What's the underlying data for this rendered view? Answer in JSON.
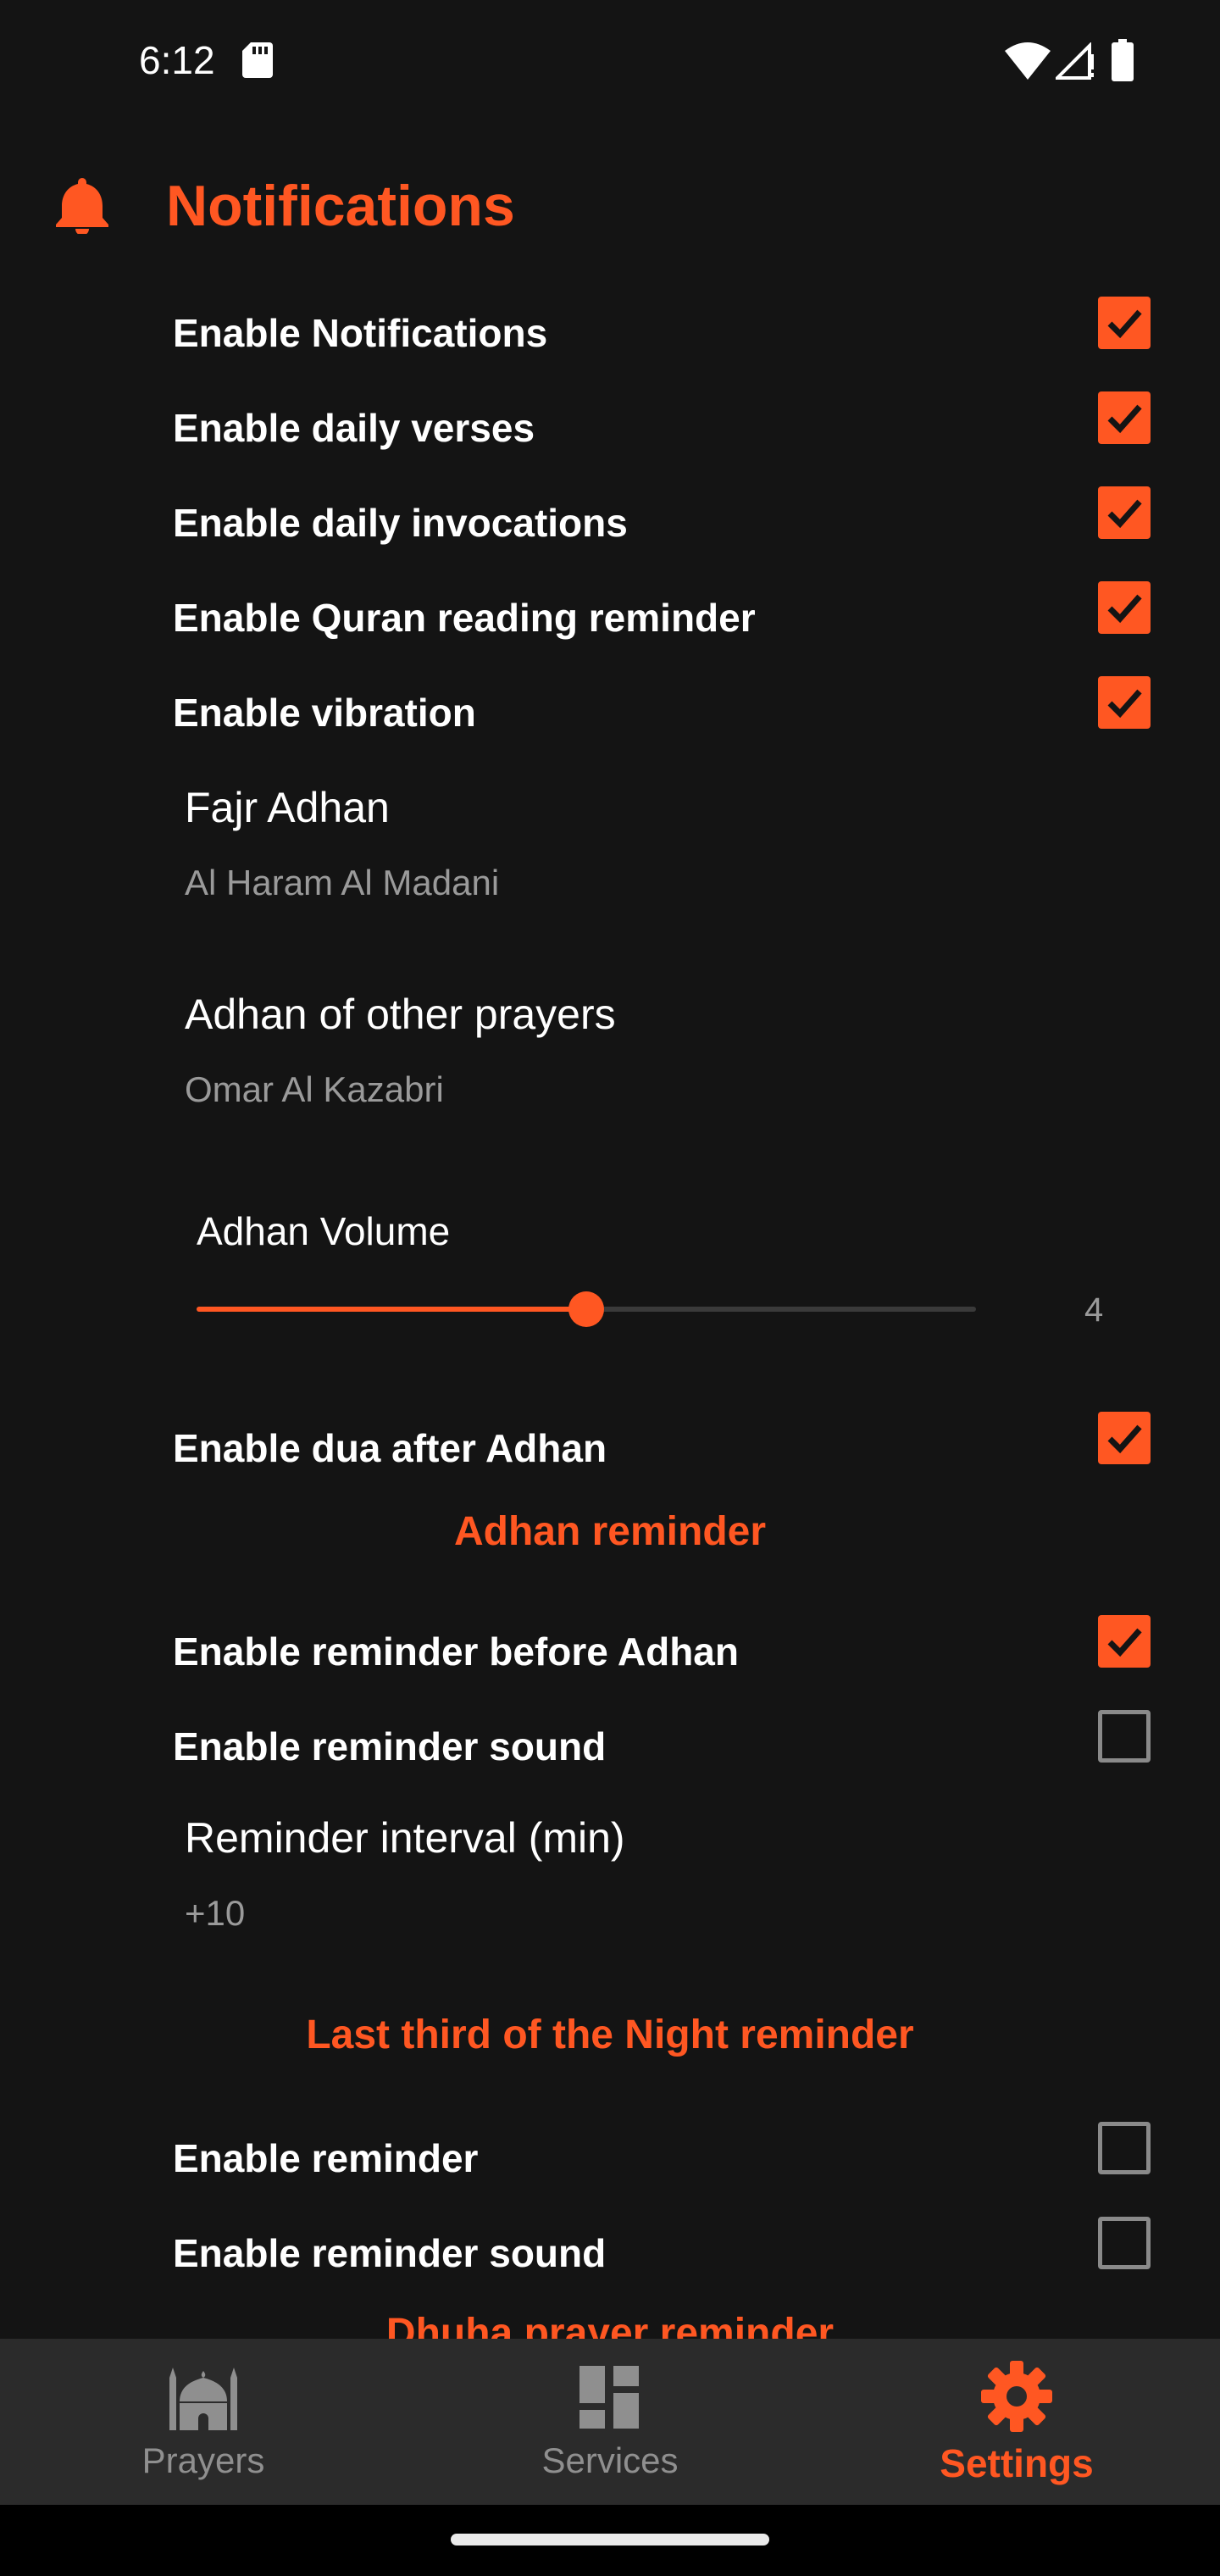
{
  "status_bar": {
    "time": "6:12"
  },
  "colors": {
    "accent": "#FF5722",
    "background": "#141414",
    "nav_background": "#2b2b2b",
    "secondary_text": "#9a9a9a"
  },
  "notifications": {
    "header": "Notifications",
    "header_icon": "bell-icon",
    "toggles": [
      {
        "label": "Enable Notifications",
        "checked": true
      },
      {
        "label": "Enable daily verses",
        "checked": true
      },
      {
        "label": "Enable daily invocations",
        "checked": true
      },
      {
        "label": "Enable Quran reading reminder",
        "checked": true
      },
      {
        "label": "Enable vibration",
        "checked": true
      }
    ],
    "fajr_adhan": {
      "title": "Fajr Adhan",
      "value": "Al Haram Al Madani"
    },
    "other_adhan": {
      "title": "Adhan of other prayers",
      "value": "Omar Al Kazabri"
    },
    "volume": {
      "title": "Adhan Volume",
      "value": "4",
      "fraction": 0.5
    },
    "dua_after_adhan": {
      "label": "Enable dua after Adhan",
      "checked": true
    }
  },
  "adhan_reminder": {
    "header": "Adhan reminder",
    "toggles": [
      {
        "label": "Enable reminder before Adhan",
        "checked": true
      },
      {
        "label": "Enable reminder sound",
        "checked": false
      }
    ],
    "interval": {
      "title": "Reminder interval (min)",
      "value": "+10"
    }
  },
  "night_reminder": {
    "header": "Last third of the Night reminder",
    "toggles": [
      {
        "label": "Enable reminder",
        "checked": false
      },
      {
        "label": "Enable reminder sound",
        "checked": false
      }
    ]
  },
  "dhuha_reminder": {
    "header": "Dhuha prayer reminder"
  },
  "bottom_nav": {
    "items": [
      {
        "label": "Prayers",
        "icon": "mosque-icon",
        "active": false
      },
      {
        "label": "Services",
        "icon": "dashboard-icon",
        "active": false
      },
      {
        "label": "Settings",
        "icon": "gear-icon",
        "active": true
      }
    ]
  }
}
